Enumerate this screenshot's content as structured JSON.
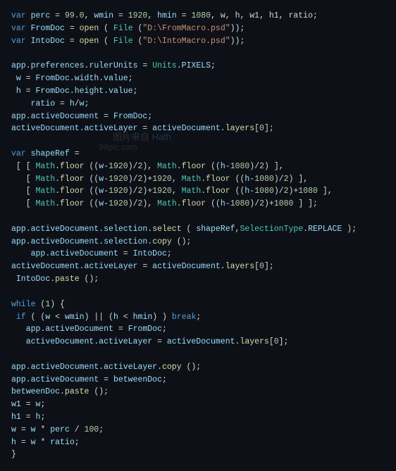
{
  "code": {
    "lines": [
      {
        "id": 1,
        "content": "var perc = 99.0, wmin = 1920, hmin = 1080, w, h, w1, h1, ratio;"
      },
      {
        "id": 2,
        "content": "var FromDoc = open ( File (\"D:\\\\FromMacro.psd\"));"
      },
      {
        "id": 3,
        "content": "var IntoDoc = open ( File (\"D:\\\\IntoMacro.psd\"));"
      },
      {
        "id": 4,
        "content": ""
      },
      {
        "id": 5,
        "content": "app.preferences.rulerUnits = Units.PIXELS;"
      },
      {
        "id": 6,
        "content": " w = FromDoc.width.value;"
      },
      {
        "id": 7,
        "content": " h = FromDoc.height.value;"
      },
      {
        "id": 8,
        "content": "    ratio = h/w;"
      },
      {
        "id": 9,
        "content": "app.activeDocument = FromDoc;"
      },
      {
        "id": 10,
        "content": "activeDocument.activeLayer = activeDocument.layers[0];"
      },
      {
        "id": 11,
        "content": ""
      },
      {
        "id": 12,
        "content": "var shapeRef ="
      },
      {
        "id": 13,
        "content": " [ [ Math.floor ((w-1920)/2), Math.floor ((h-1080)/2) ],"
      },
      {
        "id": 14,
        "content": "   [ Math.floor ((w-1920)/2)+1920, Math.floor ((h-1080)/2) ],"
      },
      {
        "id": 15,
        "content": "   [ Math.floor ((w-1920)/2)+1920, Math.floor ((h-1080)/2)+1080 ],"
      },
      {
        "id": 16,
        "content": "   [ Math.floor ((w-1920)/2), Math.floor ((h-1080)/2)+1080 ] ];"
      },
      {
        "id": 17,
        "content": ""
      },
      {
        "id": 18,
        "content": "app.activeDocument.selection.select ( shapeRef,SelectionType.REPLACE );"
      },
      {
        "id": 19,
        "content": "app.activeDocument.selection.copy ();"
      },
      {
        "id": 20,
        "content": "    app.activeDocument = IntoDoc;"
      },
      {
        "id": 21,
        "content": "activeDocument.activeLayer = activeDocument.layers[0];"
      },
      {
        "id": 22,
        "content": " IntoDoc.paste ();"
      },
      {
        "id": 23,
        "content": ""
      },
      {
        "id": 24,
        "content": "while (1) {"
      },
      {
        "id": 25,
        "content": " if ( (w < wmin) || (h < hmin) ) break;"
      },
      {
        "id": 26,
        "content": "   app.activeDocument = FromDoc;"
      },
      {
        "id": 27,
        "content": "   activeDocument.activeLayer = activeDocument.layers[0];"
      },
      {
        "id": 28,
        "content": ""
      },
      {
        "id": 29,
        "content": "app.activeDocument.activeLayer.copy ();"
      },
      {
        "id": 30,
        "content": "app.activeDocument = betweenDoc;"
      },
      {
        "id": 31,
        "content": "betweenDoc.paste ();"
      },
      {
        "id": 32,
        "content": "w1 = w;"
      },
      {
        "id": 33,
        "content": "h1 = h;"
      },
      {
        "id": 34,
        "content": "w = w * perc / 100;"
      },
      {
        "id": 35,
        "content": "h = w * ratio;"
      },
      {
        "id": 36,
        "content": "}"
      }
    ]
  },
  "watermark": {
    "line1": "图片来自",
    "line2": "99pic.com"
  }
}
